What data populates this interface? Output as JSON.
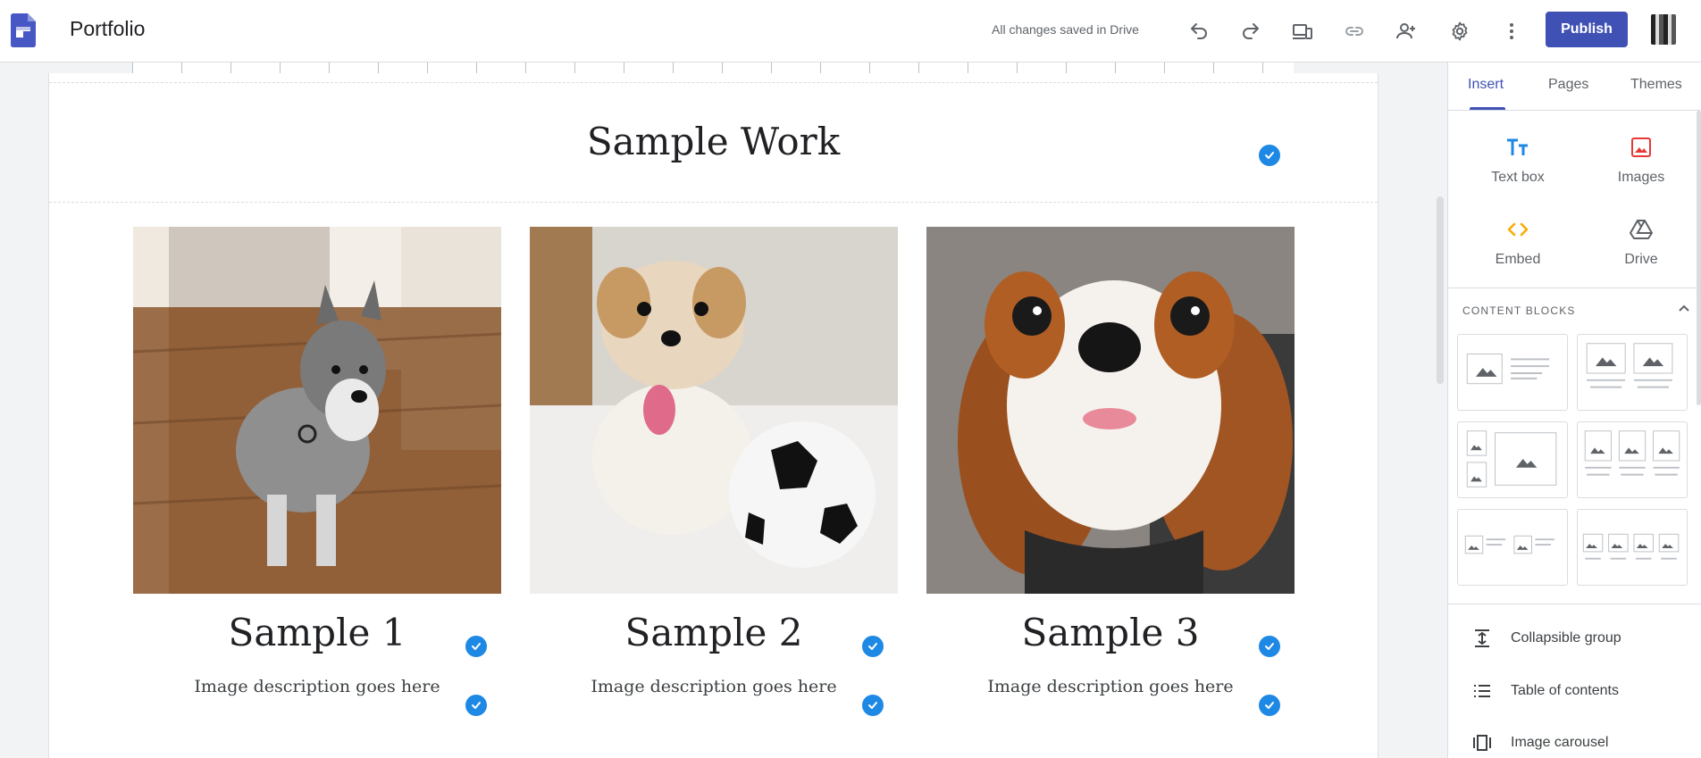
{
  "app": {
    "title": "Portfolio",
    "save_status": "All changes saved in Drive",
    "publish_label": "Publish"
  },
  "colors": {
    "accent": "#3f51b5",
    "check": "#1e88e5"
  },
  "toolbar": {
    "icons": [
      "undo-icon",
      "redo-icon",
      "preview-icon",
      "link-icon",
      "share-icon",
      "settings-icon",
      "more-icon"
    ]
  },
  "page": {
    "heading": "Sample Work",
    "cards": [
      {
        "title": "Sample 1",
        "description": "Image description goes here"
      },
      {
        "title": "Sample 2",
        "description": "Image description goes here"
      },
      {
        "title": "Sample 3",
        "description": "Image description goes here"
      }
    ]
  },
  "panel": {
    "tabs": [
      "Insert",
      "Pages",
      "Themes"
    ],
    "active_tab": "Insert",
    "insert_items": [
      {
        "label": "Text box",
        "icon": "text-box-icon"
      },
      {
        "label": "Images",
        "icon": "image-icon"
      },
      {
        "label": "Embed",
        "icon": "embed-icon"
      },
      {
        "label": "Drive",
        "icon": "drive-icon"
      }
    ],
    "content_blocks_header": "CONTENT BLOCKS",
    "list_items": [
      {
        "label": "Collapsible group",
        "icon": "collapsible-icon"
      },
      {
        "label": "Table of contents",
        "icon": "toc-icon"
      },
      {
        "label": "Image carousel",
        "icon": "carousel-icon"
      }
    ]
  }
}
